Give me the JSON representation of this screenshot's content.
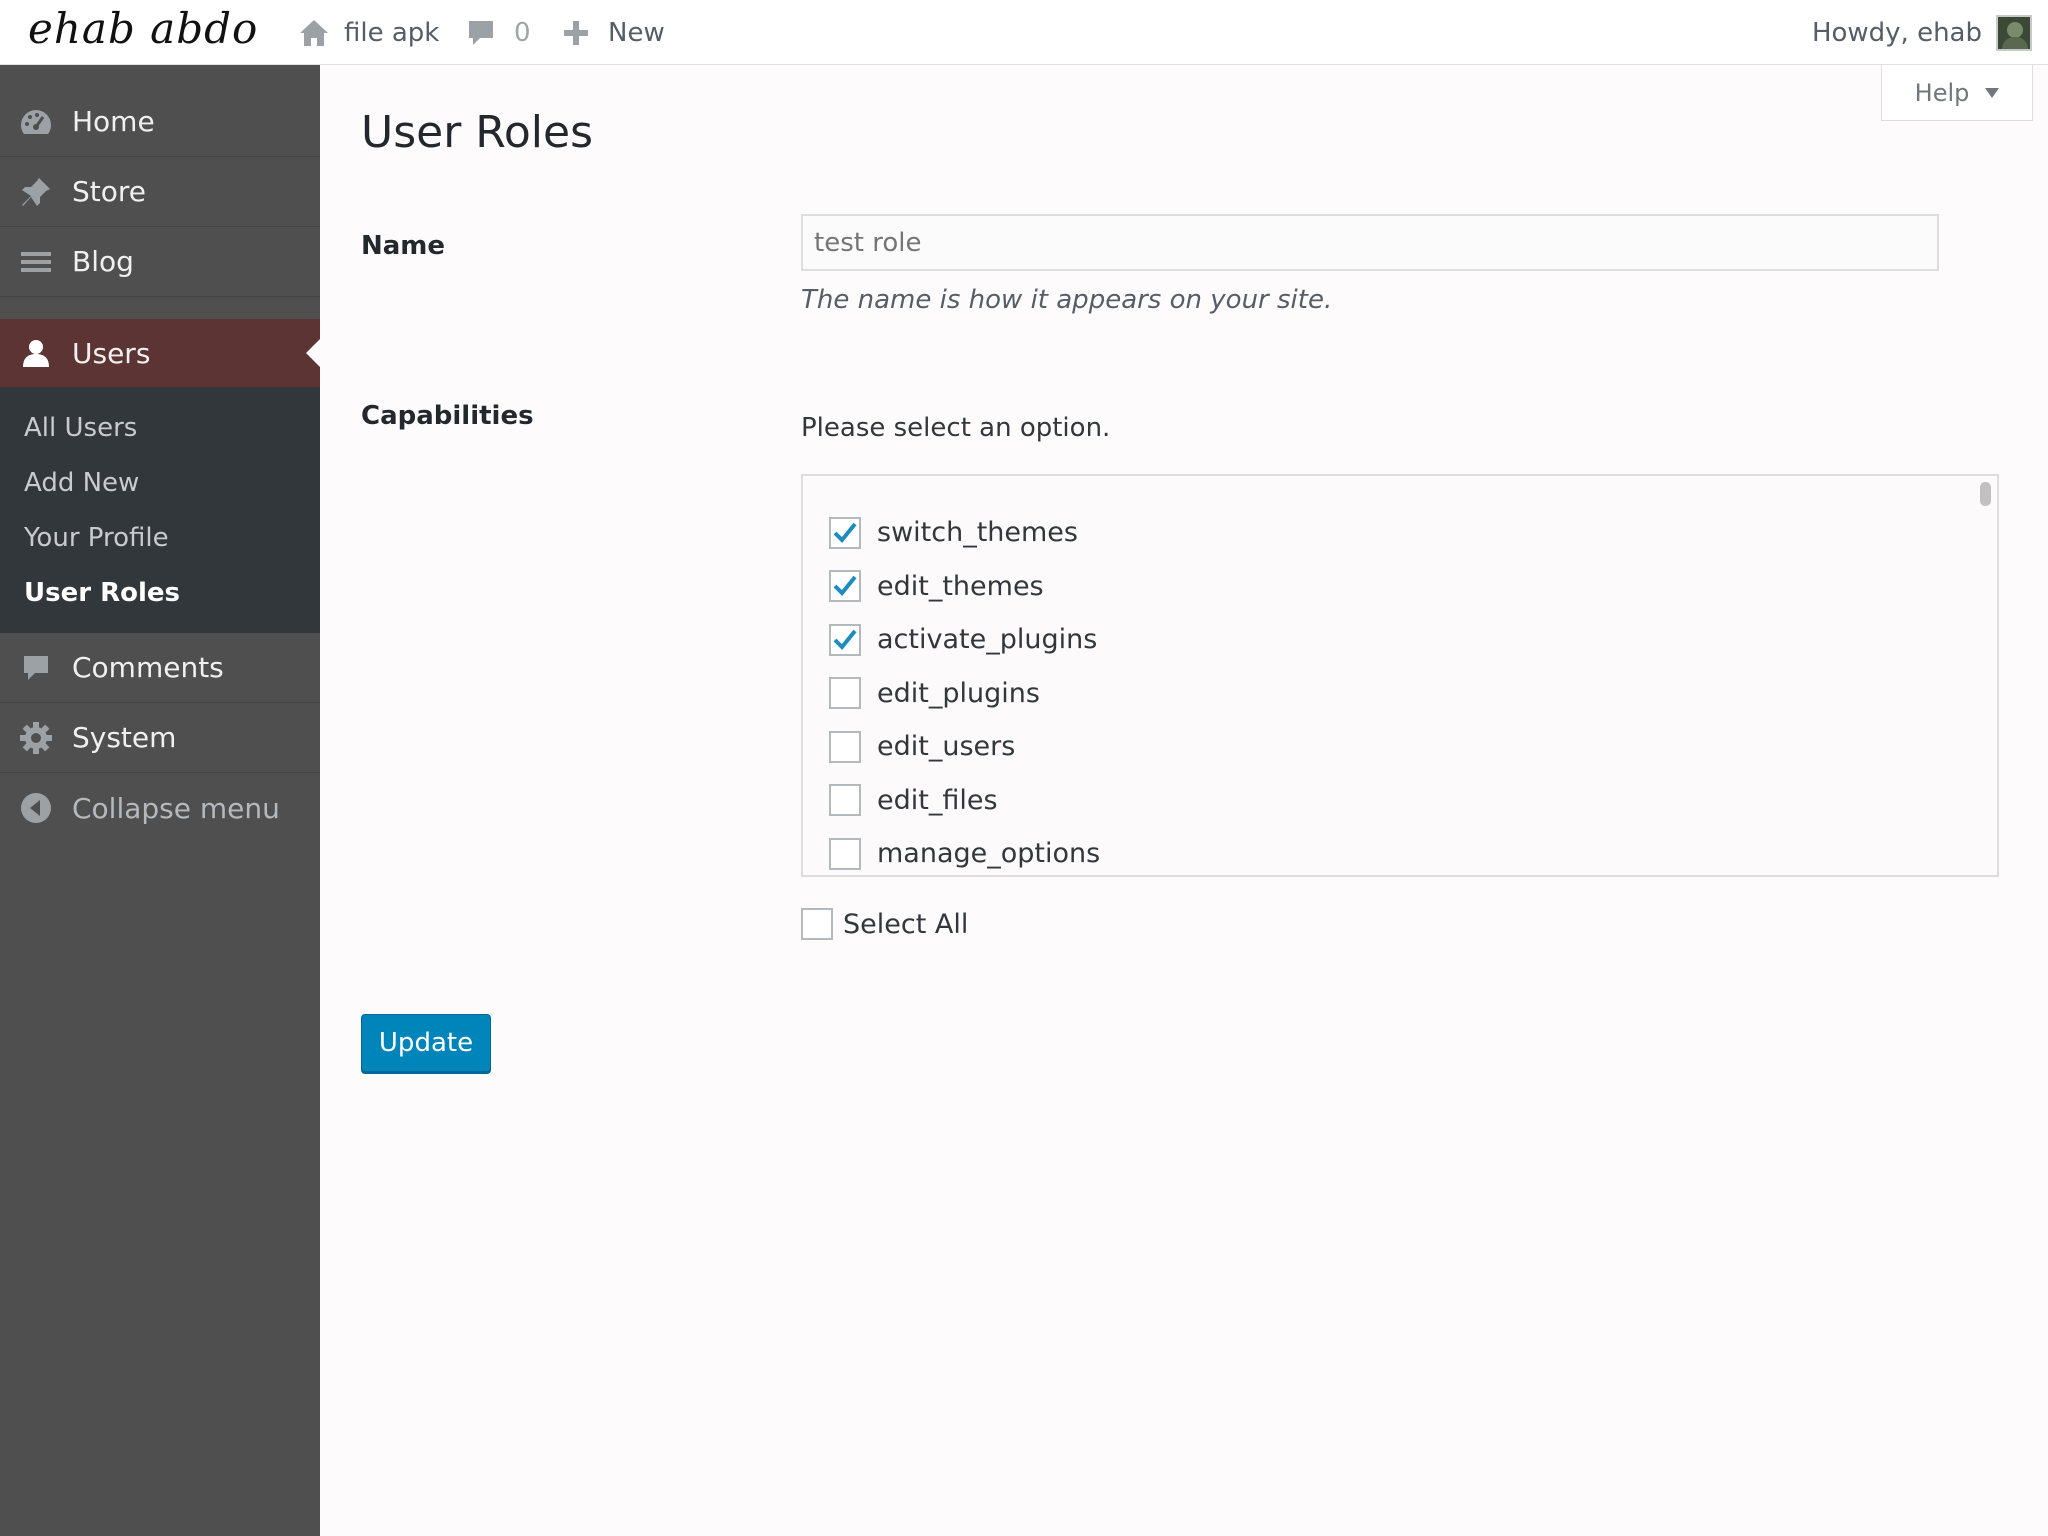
{
  "adminbar": {
    "site_logo": "ehab abdo",
    "home_label": "file apk",
    "comments_count": "0",
    "new_label": "New",
    "howdy": "Howdy, ehab"
  },
  "sidebar": {
    "items": [
      {
        "label": "Home",
        "icon": "dashboard-icon"
      },
      {
        "label": "Store",
        "icon": "pin-icon"
      },
      {
        "label": "Blog",
        "icon": "menu-lines-icon"
      }
    ],
    "active": {
      "label": "Users",
      "icon": "user-icon"
    },
    "submenu": [
      "All Users",
      "Add New",
      "Your Profile",
      "User Roles"
    ],
    "current_submenu": "User Roles",
    "after": [
      {
        "label": "Comments",
        "icon": "comment-icon"
      },
      {
        "label": "System",
        "icon": "gear-icon"
      }
    ],
    "collapse_label": "Collapse menu"
  },
  "help": {
    "label": "Help"
  },
  "page": {
    "title": "User Roles",
    "name_label": "Name",
    "name_placeholder": "test role",
    "name_description": "The name is how it appears on your site.",
    "capabilities_label": "Capabilities",
    "capabilities_prompt": "Please select an option.",
    "capabilities": [
      {
        "name": "switch_themes",
        "checked": true
      },
      {
        "name": "edit_themes",
        "checked": true
      },
      {
        "name": "activate_plugins",
        "checked": true
      },
      {
        "name": "edit_plugins",
        "checked": false
      },
      {
        "name": "edit_users",
        "checked": false
      },
      {
        "name": "edit_files",
        "checked": false
      },
      {
        "name": "manage_options",
        "checked": false
      }
    ],
    "select_all_label": "Select All",
    "update_label": "Update"
  },
  "colors": {
    "accent": "#0085ba",
    "sidebar_bg": "#4f4f4f",
    "active_menu_bg": "#5c3434",
    "submenu_bg": "#32373c",
    "check_color": "#1e8cbe"
  }
}
